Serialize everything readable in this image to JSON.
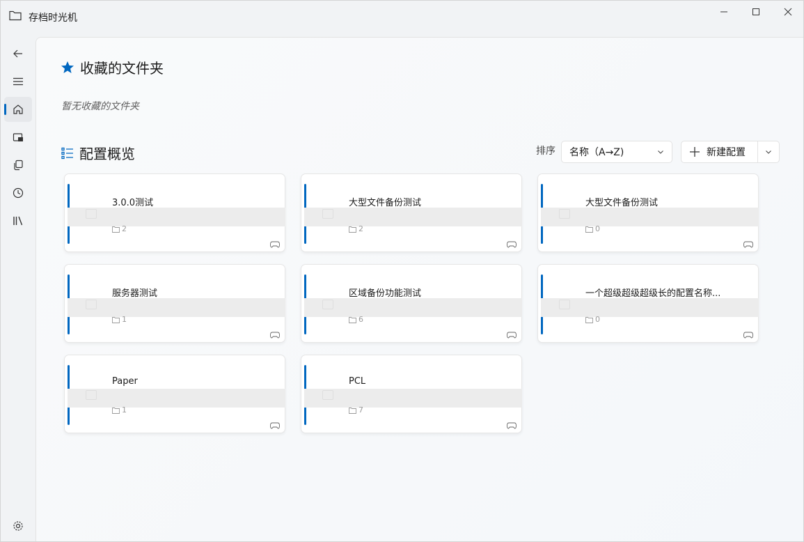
{
  "window": {
    "title": "存档时光机"
  },
  "favorites": {
    "title": "收藏的文件夹",
    "empty_text": "暂无收藏的文件夹"
  },
  "overview": {
    "title": "配置概览",
    "sort_label": "排序",
    "sort_value": "名称（A→Z)",
    "new_button_label": "新建配置"
  },
  "cards": [
    {
      "name": "3.0.0测试",
      "count": "2"
    },
    {
      "name": "大型文件备份测试",
      "count": "2"
    },
    {
      "name": "大型文件备份测试",
      "count": "0"
    },
    {
      "name": "服务器测试",
      "count": "1"
    },
    {
      "name": "区域备份功能测试",
      "count": "6"
    },
    {
      "name": "一个超级超级超级长的配置名称...",
      "count": "0"
    },
    {
      "name": "Paper",
      "count": "1"
    },
    {
      "name": "PCL",
      "count": "7"
    }
  ],
  "colors": {
    "accent": "#0067c0",
    "favorite_star": "#0067c0"
  },
  "icons": {
    "nav": [
      "back-arrow-icon",
      "hamburger-menu-icon",
      "home-icon",
      "backup-icon",
      "copy-icon",
      "history-icon",
      "library-icon",
      "settings-icon"
    ]
  }
}
